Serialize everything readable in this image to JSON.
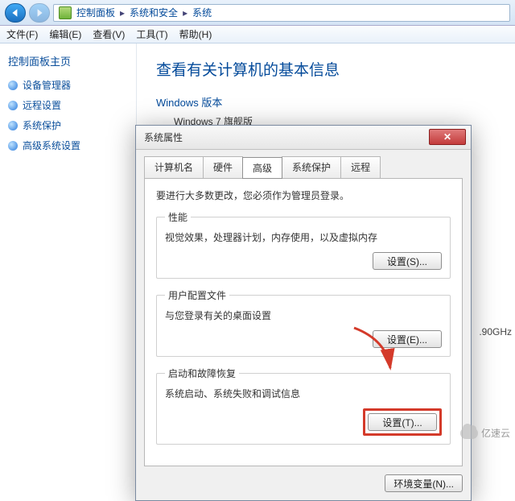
{
  "breadcrumb": {
    "root": "控制面板",
    "mid": "系统和安全",
    "leaf": "系统"
  },
  "menu": {
    "file": "文件(F)",
    "edit": "编辑(E)",
    "view": "查看(V)",
    "tools": "工具(T)",
    "help": "帮助(H)"
  },
  "sidebar": {
    "home": "控制面板主页",
    "items": [
      {
        "label": "设备管理器"
      },
      {
        "label": "远程设置"
      },
      {
        "label": "系统保护"
      },
      {
        "label": "高级系统设置"
      }
    ]
  },
  "content": {
    "heading": "查看有关计算机的基本信息",
    "sub": "Windows 版本",
    "edition": "Windows 7 旗舰版",
    "ghz": ".90GHz"
  },
  "dialog": {
    "title": "系统属性",
    "tabs": {
      "t0": "计算机名",
      "t1": "硬件",
      "t2": "高级",
      "t3": "系统保护",
      "t4": "远程"
    },
    "note": "要进行大多数更改，您必须作为管理员登录。",
    "g1": {
      "legend": "性能",
      "desc": "视觉效果，处理器计划，内存使用，以及虚拟内存",
      "btn": "设置(S)..."
    },
    "g2": {
      "legend": "用户配置文件",
      "desc": "与您登录有关的桌面设置",
      "btn": "设置(E)..."
    },
    "g3": {
      "legend": "启动和故障恢复",
      "desc": "系统启动、系统失败和调试信息",
      "btn": "设置(T)..."
    },
    "env": "环境变量(N)..."
  },
  "watermark": "亿速云"
}
